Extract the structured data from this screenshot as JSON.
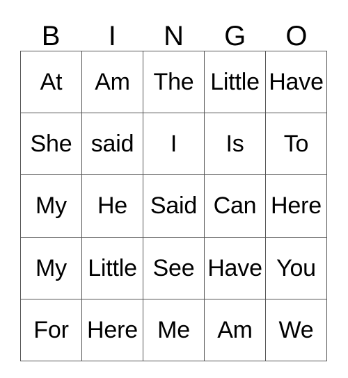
{
  "card": {
    "title": "BINGO",
    "header_letters": [
      "B",
      "I",
      "N",
      "G",
      "O"
    ],
    "grid_size": "5x5",
    "border_color": "#555555",
    "background_color": "#ffffff",
    "text_color": "#000000",
    "rows": [
      {
        "cells": [
          "At",
          "Am",
          "The",
          "Little",
          "Have"
        ]
      },
      {
        "cells": [
          "She",
          "said",
          "I",
          "Is",
          "To"
        ]
      },
      {
        "cells": [
          "My",
          "He",
          "Said",
          "Can",
          "Here"
        ]
      },
      {
        "cells": [
          "My",
          "Little",
          "See",
          "Have",
          "You"
        ]
      },
      {
        "cells": [
          "For",
          "Here",
          "Me",
          "Am",
          "We"
        ]
      }
    ]
  }
}
